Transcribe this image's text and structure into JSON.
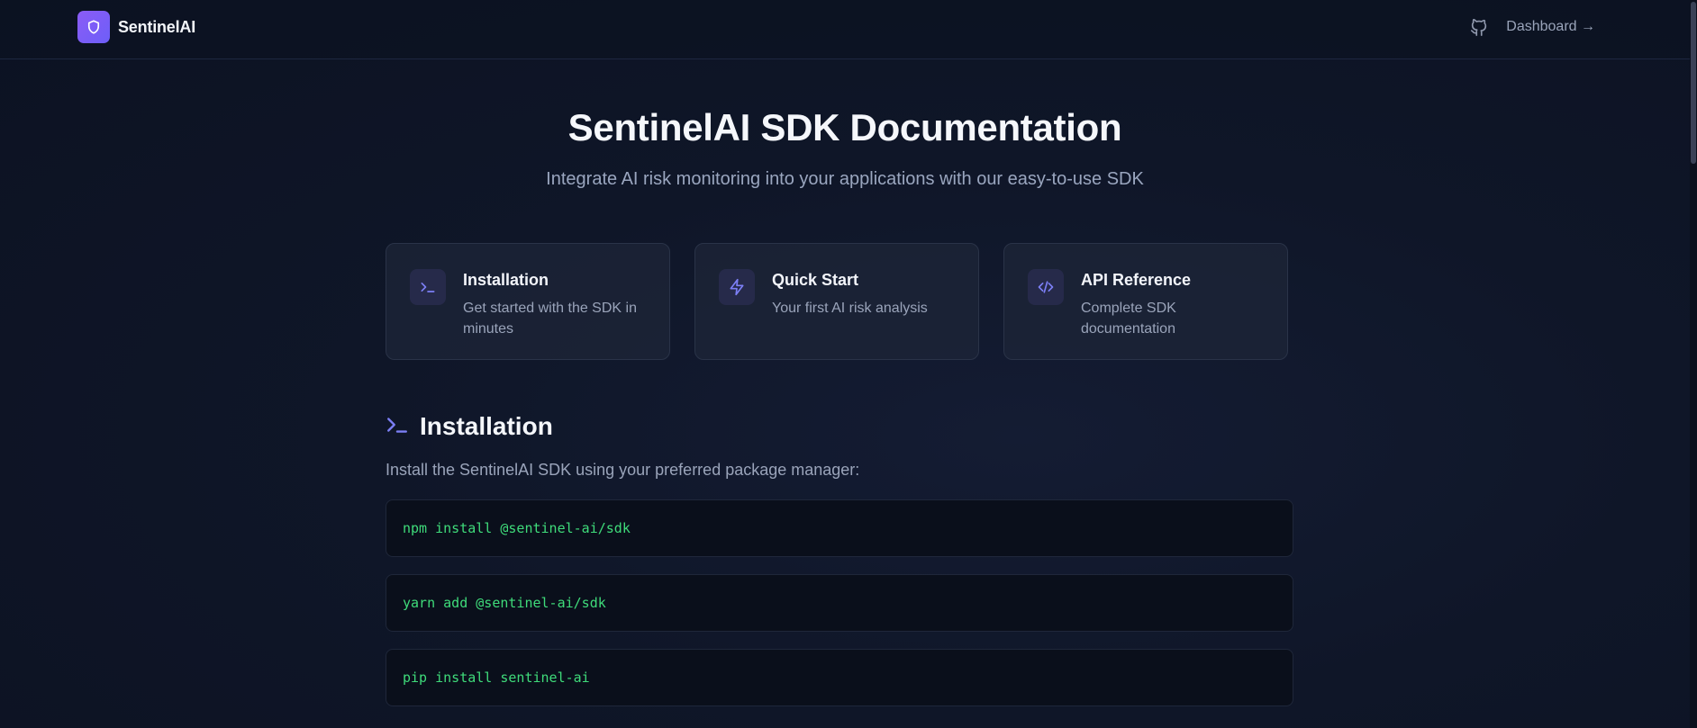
{
  "header": {
    "brand_name": "SentinelAI",
    "dashboard_label": "Dashboard →",
    "icons": {
      "logo": "shield-icon",
      "github": "github-icon"
    },
    "accent_color": "#8b5cf6"
  },
  "hero": {
    "title": "SentinelAI SDK Documentation",
    "subtitle": "Integrate AI risk monitoring into your applications with our easy-to-use SDK"
  },
  "cards": [
    {
      "title": "Installation",
      "description": "Get started with the SDK in minutes",
      "icon": "terminal-icon"
    },
    {
      "title": "Quick Start",
      "description": "Your first AI risk analysis",
      "icon": "lightning-icon"
    },
    {
      "title": "API Reference",
      "description": "Complete SDK documentation",
      "icon": "code-icon"
    }
  ],
  "installation": {
    "title": "Installation",
    "icon": "terminal-icon",
    "description": "Install the SentinelAI SDK using your preferred package manager:",
    "commands": [
      "npm install @sentinel-ai/sdk",
      "yarn add @sentinel-ai/sdk",
      "pip install sentinel-ai"
    ],
    "code_color": "#3fdb7a"
  }
}
